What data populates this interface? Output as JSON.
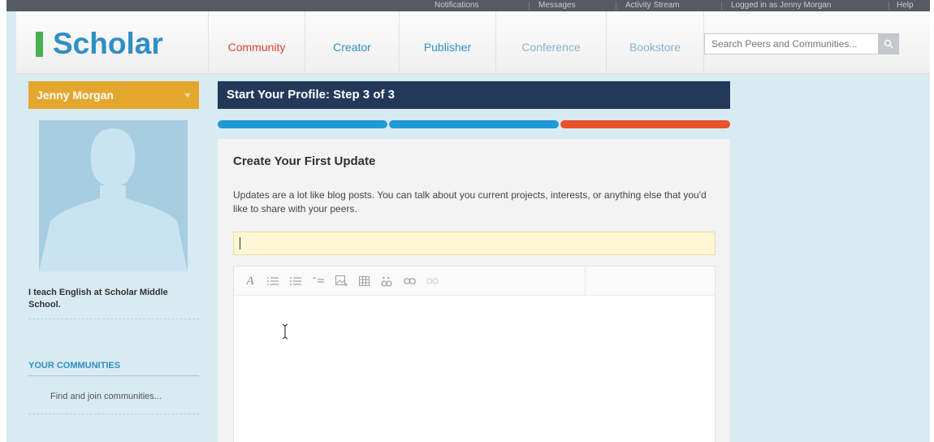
{
  "topbar": {
    "items": [
      "Notifications",
      "Messages",
      "Activity Stream",
      "Logged in as Jenny Morgan",
      "Help"
    ]
  },
  "logo": {
    "text": "Scholar",
    "mark_color": "#4caf50",
    "text_color": "#2f8fc4"
  },
  "nav": {
    "items": [
      {
        "label": "Community",
        "color": "#d9452f"
      },
      {
        "label": "Creator",
        "color": "#2f8fc4"
      },
      {
        "label": "Publisher",
        "color": "#2f8fc4"
      },
      {
        "label": "Conference",
        "color": "#8ab2c7"
      },
      {
        "label": "Bookstore",
        "color": "#8ab2c7"
      }
    ]
  },
  "search": {
    "placeholder": "Search Peers and Communities...",
    "icon": "search-icon"
  },
  "sidebar": {
    "user_name": "Jenny Morgan",
    "bio": "I teach English at Scholar Middle School.",
    "communities_title": "YOUR COMMUNITIES",
    "communities_link": "Find and join communities..."
  },
  "main": {
    "step_title": "Start Your Profile: Step 3 of 3",
    "progress": {
      "current_step": 3,
      "total_steps": 3,
      "colors": [
        "#1f9ad6",
        "#1f9ad6",
        "#e8532a"
      ]
    },
    "card_title": "Create Your First Update",
    "card_description": "Updates are a lot like blog posts. You can talk about you current projects, interests, or anything else that you'd like to share with your peers.",
    "title_input_value": "",
    "toolbar": [
      "font-style-icon",
      "ordered-list-icon",
      "unordered-list-icon",
      "indent-icon",
      "insert-image-icon",
      "insert-table-icon",
      "insert-video-icon",
      "link-icon",
      "unlink-icon"
    ],
    "body_value": ""
  }
}
